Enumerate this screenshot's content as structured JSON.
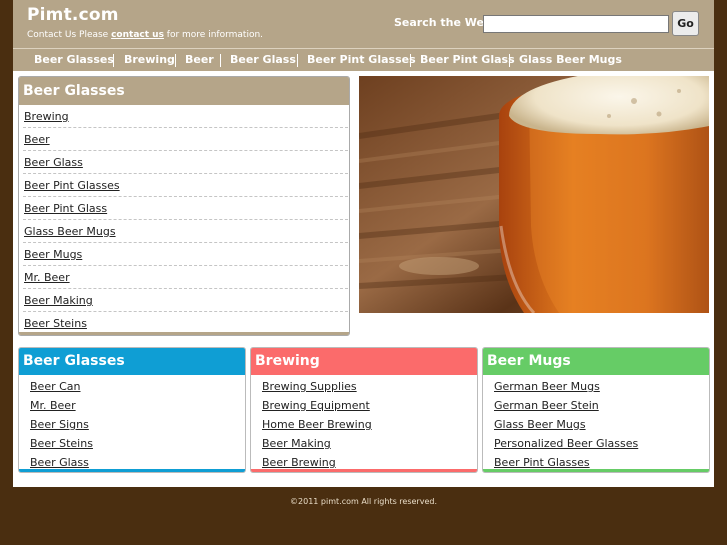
{
  "header": {
    "site_title": "Pimt.com",
    "contact_prefix": "Contact Us Please ",
    "contact_link": "contact us",
    "contact_suffix": " for more information.",
    "search_label": "Search the Web:",
    "search_value": "",
    "go_label": "Go"
  },
  "nav": {
    "items": [
      {
        "label": "Beer Glasses"
      },
      {
        "label": "Brewing"
      },
      {
        "label": "Beer"
      },
      {
        "label": "Beer Glass"
      },
      {
        "label": "Beer Pint Glasses"
      },
      {
        "label": "Beer Pint Glass"
      },
      {
        "label": "Glass Beer Mugs"
      }
    ]
  },
  "sidebar": {
    "title": "Beer Glasses",
    "links": [
      {
        "label": "Brewing"
      },
      {
        "label": "Beer"
      },
      {
        "label": "Beer Glass"
      },
      {
        "label": "Beer Pint Glasses"
      },
      {
        "label": "Beer Pint Glass"
      },
      {
        "label": "Glass Beer Mugs"
      },
      {
        "label": "Beer Mugs"
      },
      {
        "label": "Mr. Beer"
      },
      {
        "label": "Beer Making"
      },
      {
        "label": "Beer Steins"
      }
    ]
  },
  "categories": [
    {
      "title": "Beer Glasses",
      "color": "#0f9ed4",
      "links": [
        {
          "label": "Beer Can"
        },
        {
          "label": "Mr. Beer"
        },
        {
          "label": "Beer Signs"
        },
        {
          "label": "Beer Steins"
        },
        {
          "label": "Beer Glass"
        }
      ]
    },
    {
      "title": "Brewing",
      "color": "#fb6b6b",
      "links": [
        {
          "label": "Brewing Supplies"
        },
        {
          "label": "Brewing Equipment"
        },
        {
          "label": "Home Beer Brewing"
        },
        {
          "label": "Beer Making"
        },
        {
          "label": "Beer Brewing"
        }
      ]
    },
    {
      "title": "Beer Mugs",
      "color": "#66cc66",
      "links": [
        {
          "label": "German Beer Mugs"
        },
        {
          "label": "German Beer Stein"
        },
        {
          "label": "Glass Beer Mugs"
        },
        {
          "label": "Personalized Beer Glasses"
        },
        {
          "label": "Beer Pint Glasses"
        }
      ]
    }
  ],
  "footer": {
    "copyright": "©2011 pimt.com All rights reserved."
  },
  "colors": {
    "header_bg": "#b5a589",
    "page_bg": "#4a2e10"
  }
}
